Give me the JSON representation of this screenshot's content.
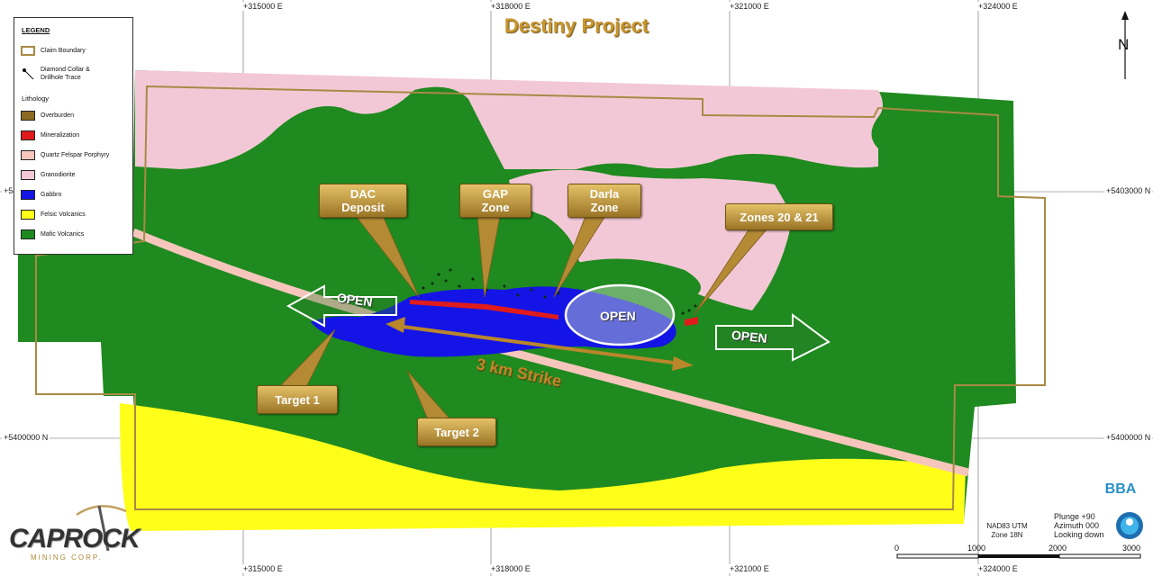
{
  "map": {
    "title": "Destiny Project",
    "grid_labels": {
      "top": [
        "+315000 E",
        "+318000 E",
        "+321000 E",
        "+324000 E"
      ],
      "bottom": [
        "+315000 E",
        "+318000 E",
        "+321000 E",
        "+324000 E"
      ],
      "left": [
        "+54",
        "+5400000 N"
      ],
      "right": [
        "+5403000 N",
        "+5400000 N"
      ]
    },
    "callouts": {
      "dac": "DAC\nDeposit",
      "gap": "GAP\nZone",
      "darla": "Darla\nZone",
      "zones": "Zones 20 & 21",
      "target1": "Target 1",
      "target2": "Target 2"
    },
    "open_left": "OPEN",
    "open_center": "OPEN",
    "open_right": "OPEN",
    "strike_label": "3 km Strike",
    "north_label": "N",
    "projection": {
      "line1": "NAD83 UTM",
      "line2": "Zone 18N"
    },
    "view": {
      "plunge": "Plunge +90",
      "azimuth": "Azimuth 000",
      "looking": "Looking down"
    },
    "scale_labels": [
      "0",
      "1000",
      "2000",
      "3000"
    ]
  },
  "legend": {
    "title": "LEGEND",
    "claim_boundary": "Claim Boundary",
    "drill_trace": "Diamond Collar &\nDrillhole Trace",
    "lithology_title": "Lithology",
    "items": [
      {
        "label": "Overburden",
        "color": "#8b6a23"
      },
      {
        "label": "Mineralization",
        "color": "#e01b1b"
      },
      {
        "label": "Quartz Felspar Porphyry",
        "color": "#f6c6bc"
      },
      {
        "label": "Granodiorite",
        "color": "#f3c8d6"
      },
      {
        "label": "Gabbro",
        "color": "#1414e6"
      },
      {
        "label": "Felsic Volcanics",
        "color": "#ffff1a"
      },
      {
        "label": "Mafic Volcanics",
        "color": "#1f8a1f"
      }
    ]
  },
  "logo": {
    "name": "CAPROCK",
    "sub": "MINING CORP."
  },
  "bba_logo": "BBA"
}
